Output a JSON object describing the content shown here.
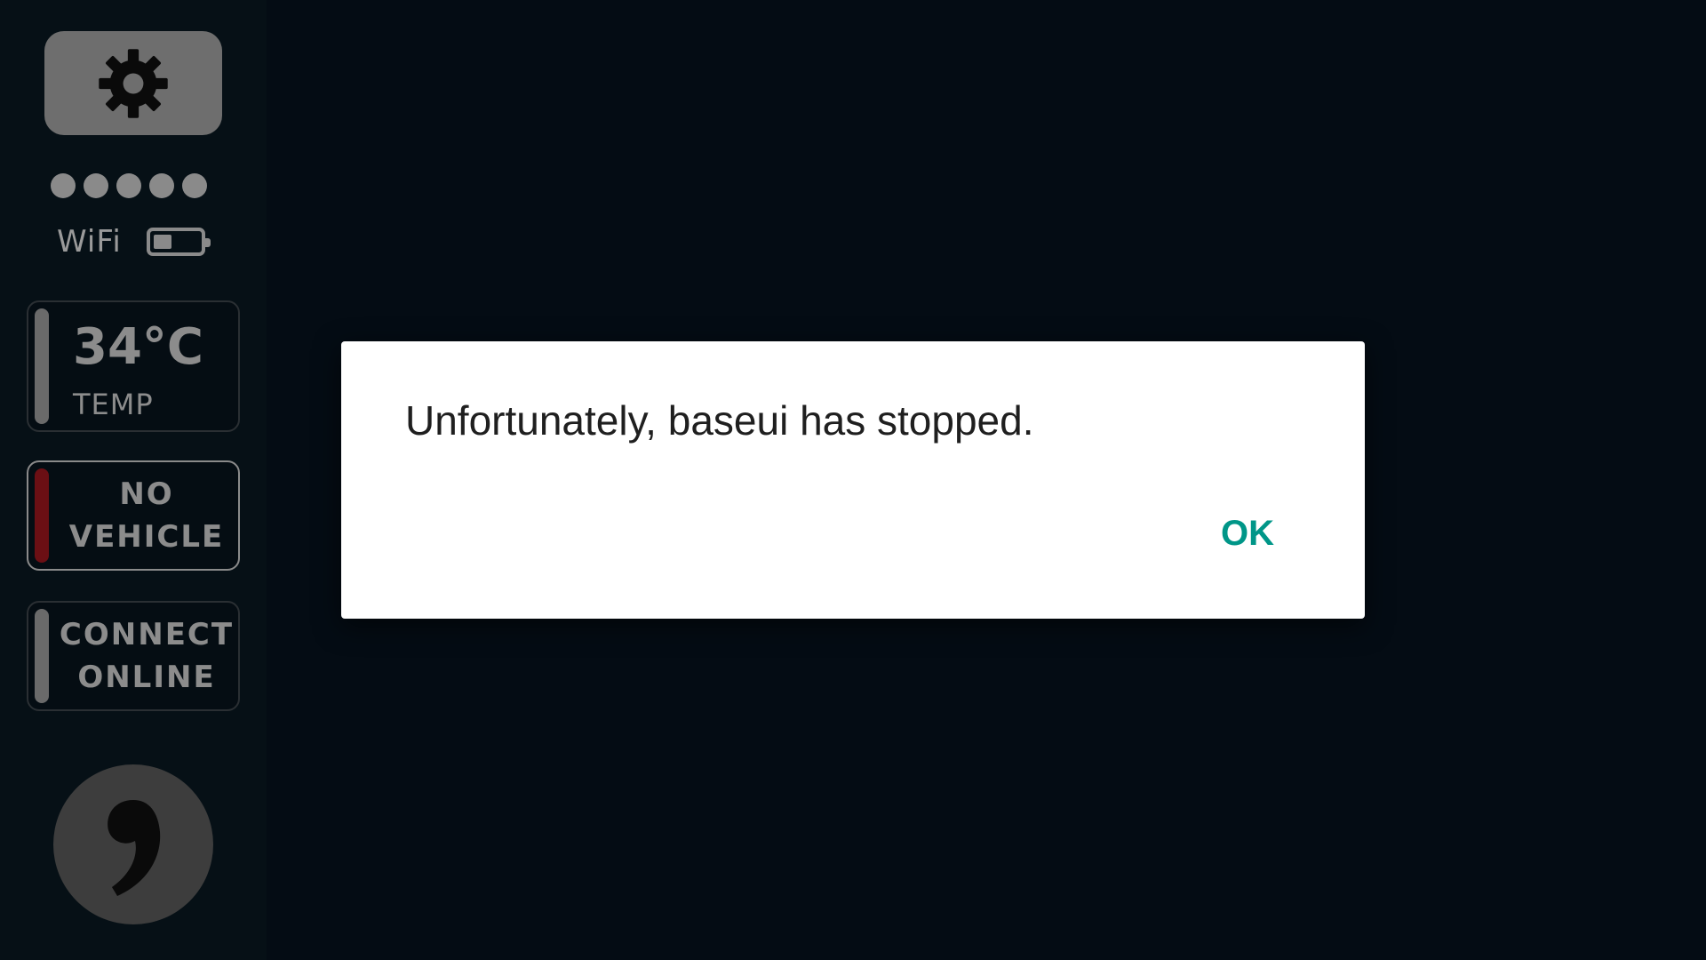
{
  "sidebar": {
    "settings_icon": "gear-icon",
    "signal_bars": 5,
    "wifi_label": "WiFi",
    "battery_level": 0.4,
    "temp": {
      "value": "34°C",
      "label": "TEMP"
    },
    "vehicle": {
      "line1": "NO",
      "line2": "VEHICLE",
      "status_color": "#6b0f14"
    },
    "connect": {
      "line1": "CONNECT",
      "line2": "ONLINE"
    },
    "logo_icon": "comma-logo-icon"
  },
  "dialog": {
    "message": "Unfortunately, baseui has stopped.",
    "ok_label": "OK",
    "accent_color": "#009688"
  }
}
